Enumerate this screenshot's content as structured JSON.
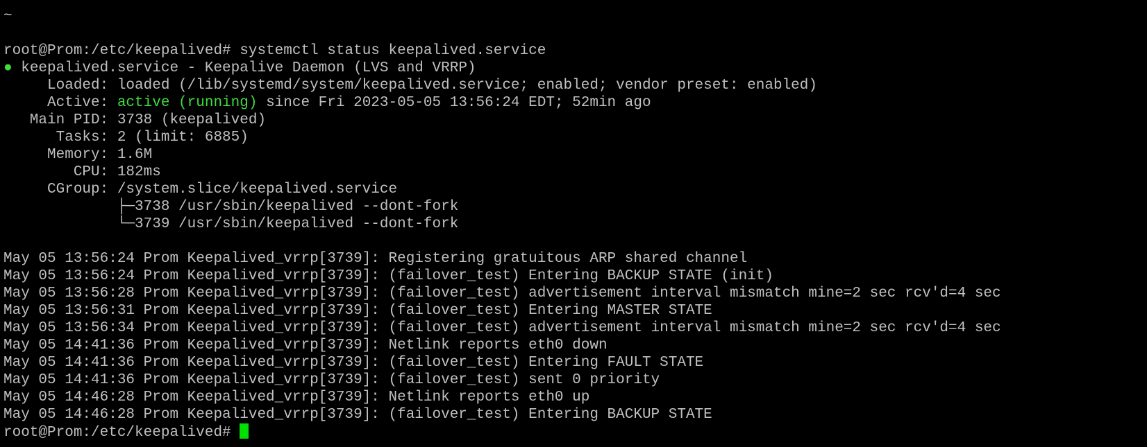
{
  "terminal": {
    "top_lines": [
      "~",
      "~"
    ],
    "prompt": "root@Prom:/etc/keepalived# ",
    "command": "systemctl status keepalived.service",
    "status_dot": "●",
    "service_header": " keepalived.service - Keepalive Daemon (LVS and VRRP)",
    "loaded": "     Loaded: loaded (/lib/systemd/system/keepalived.service; enabled; vendor preset: enabled)",
    "active_label": "     Active: ",
    "active_state": "active (running)",
    "active_since": " since Fri 2023-05-05 13:56:24 EDT; 52min ago",
    "main_pid": "   Main PID: 3738 (keepalived)",
    "tasks": "      Tasks: 2 (limit: 6885)",
    "memory": "     Memory: 1.6M",
    "cpu": "        CPU: 182ms",
    "cgroup": "     CGroup: /system.slice/keepalived.service",
    "cgroup_children": [
      "             ├─3738 /usr/sbin/keepalived --dont-fork",
      "             └─3739 /usr/sbin/keepalived --dont-fork"
    ],
    "log_lines": [
      "May 05 13:56:24 Prom Keepalived_vrrp[3739]: Registering gratuitous ARP shared channel",
      "May 05 13:56:24 Prom Keepalived_vrrp[3739]: (failover_test) Entering BACKUP STATE (init)",
      "May 05 13:56:28 Prom Keepalived_vrrp[3739]: (failover_test) advertisement interval mismatch mine=2 sec rcv'd=4 sec",
      "May 05 13:56:31 Prom Keepalived_vrrp[3739]: (failover_test) Entering MASTER STATE",
      "May 05 13:56:34 Prom Keepalived_vrrp[3739]: (failover_test) advertisement interval mismatch mine=2 sec rcv'd=4 sec",
      "May 05 14:41:36 Prom Keepalived_vrrp[3739]: Netlink reports eth0 down",
      "May 05 14:41:36 Prom Keepalived_vrrp[3739]: (failover_test) Entering FAULT STATE",
      "May 05 14:41:36 Prom Keepalived_vrrp[3739]: (failover_test) sent 0 priority",
      "May 05 14:46:28 Prom Keepalived_vrrp[3739]: Netlink reports eth0 up",
      "May 05 14:46:28 Prom Keepalived_vrrp[3739]: (failover_test) Entering BACKUP STATE"
    ],
    "final_prompt": "root@Prom:/etc/keepalived# "
  },
  "colors": {
    "background": "#000000",
    "text": "#c0c0c0",
    "active": "#3fdc3f",
    "cursor": "#00e000"
  }
}
